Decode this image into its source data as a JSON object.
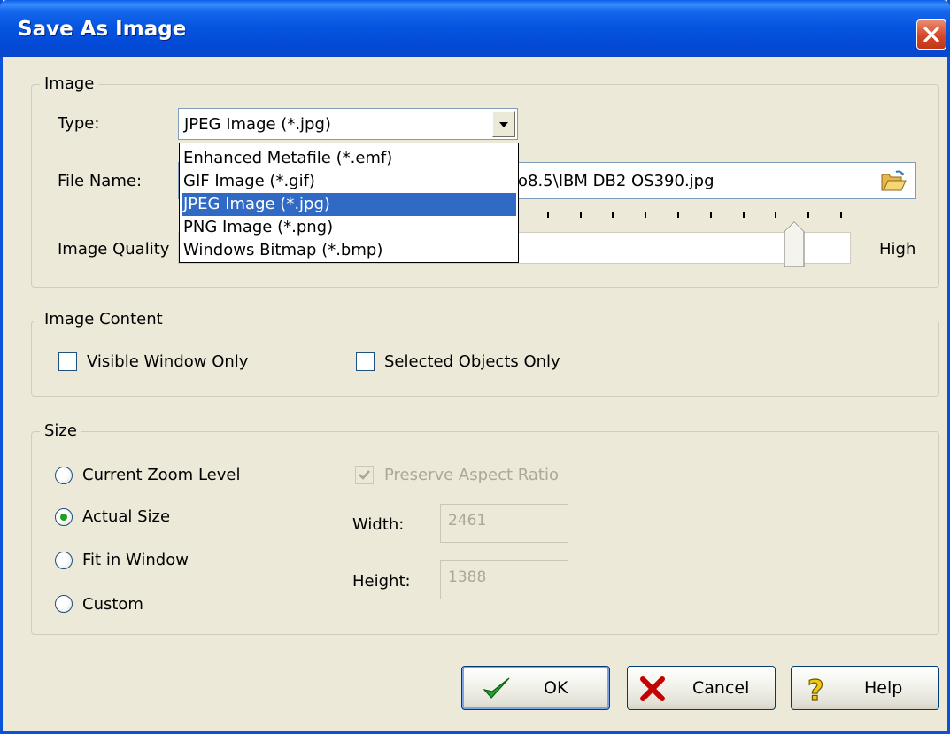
{
  "window": {
    "title": "Save As Image"
  },
  "image_group": {
    "legend": "Image",
    "type_label": "Type:",
    "type_value": "JPEG Image (*.jpg)",
    "type_options": [
      "Enhanced Metafile (*.emf)",
      "GIF Image (*.gif)",
      "JPEG Image (*.jpg)",
      "PNG Image (*.png)",
      "Windows Bitmap (*.bmp)"
    ],
    "selected_option": "JPEG Image (*.jpg)",
    "file_name_label": "File Name:",
    "file_name_visible_text": "o8.5\\IBM DB2 OS390.jpg",
    "image_quality_label": "Image Quality",
    "quality_high_label": "High",
    "quality_fraction": 0.93
  },
  "content_group": {
    "legend": "Image Content",
    "visible_window_only": {
      "label": "Visible Window Only",
      "checked": false
    },
    "selected_objects_only": {
      "label": "Selected Objects Only",
      "checked": false
    }
  },
  "size_group": {
    "legend": "Size",
    "options": [
      {
        "label": "Current Zoom Level",
        "selected": false
      },
      {
        "label": "Actual Size",
        "selected": true
      },
      {
        "label": "Fit in Window",
        "selected": false
      },
      {
        "label": "Custom",
        "selected": false
      }
    ],
    "preserve_aspect_ratio": {
      "label": "Preserve Aspect Ratio",
      "checked": true,
      "enabled": false
    },
    "width_label": "Width:",
    "width_value": "2461",
    "height_label": "Height:",
    "height_value": "1388"
  },
  "buttons": {
    "ok": "OK",
    "cancel": "Cancel",
    "help": "Help"
  },
  "icons": {
    "ok": "green-checkmark-icon",
    "cancel": "red-x-icon",
    "help": "question-mark-icon",
    "browse": "open-folder-icon",
    "close": "close-icon"
  },
  "colors": {
    "title_bar": "#0554E0",
    "selection": "#316AC5",
    "close_button": "#D5472A"
  }
}
